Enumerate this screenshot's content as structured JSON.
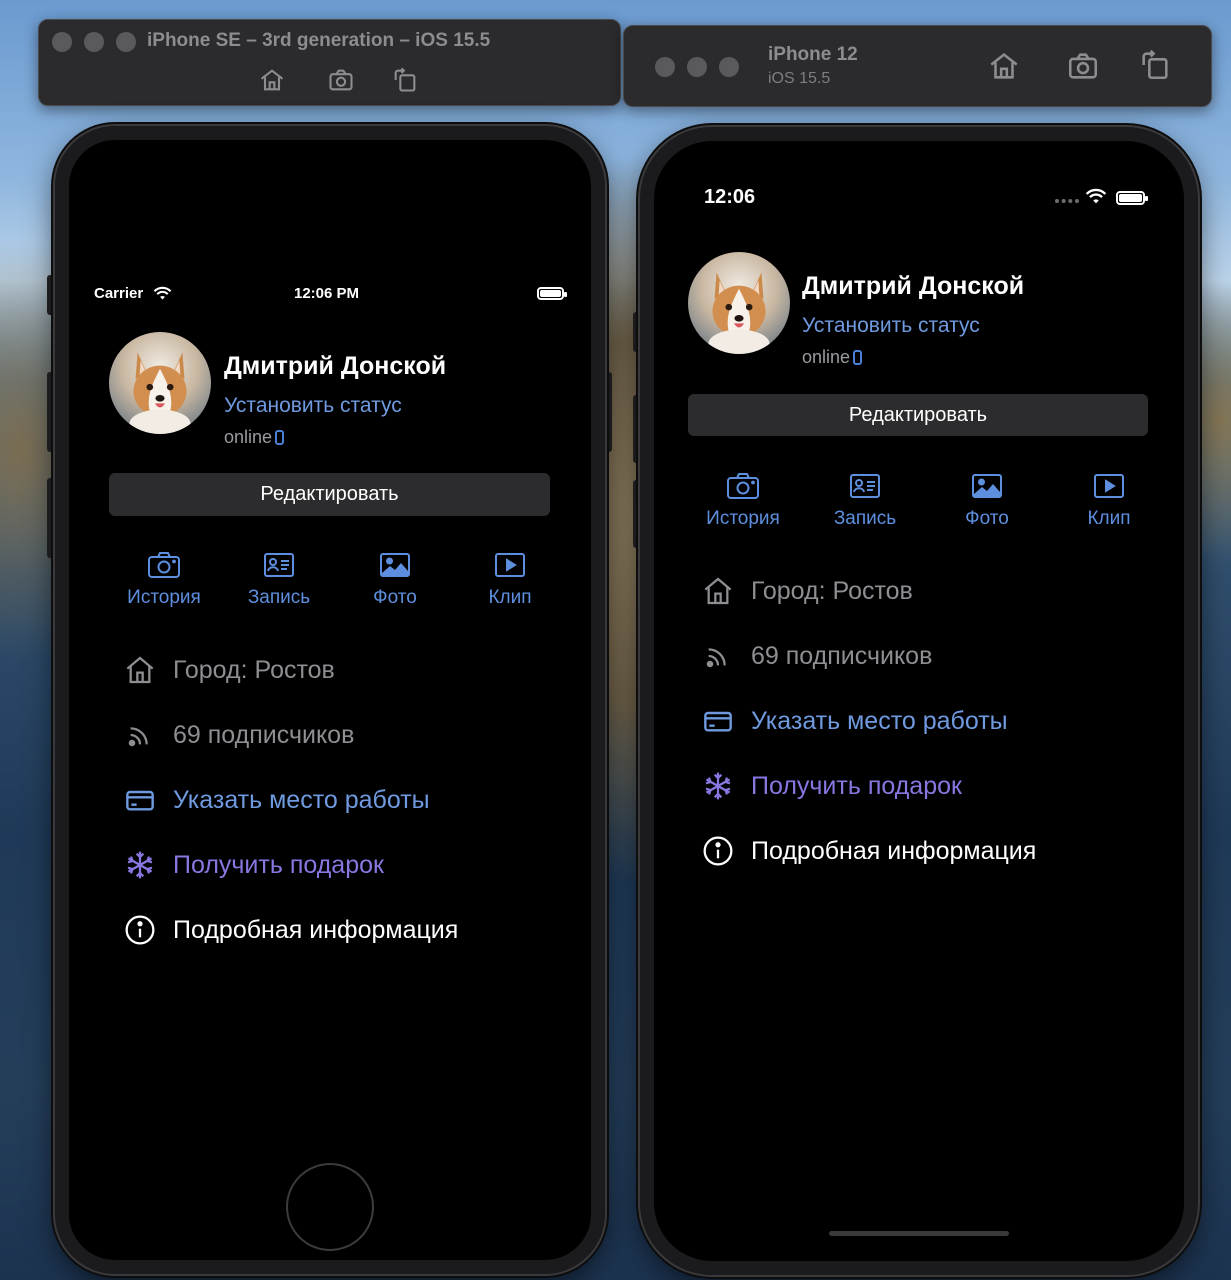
{
  "simulators": [
    {
      "title": "iPhone SE – 3rd generation – iOS 15.5",
      "status_bar": {
        "carrier": "Carrier",
        "time": "12:06 PM"
      }
    },
    {
      "title": "iPhone 12",
      "subtitle": "iOS 15.5",
      "status_bar": {
        "time": "12:06"
      }
    }
  ],
  "profile": {
    "name": "Дмитрий Донской",
    "status_link": "Установить статус",
    "online": "online",
    "edit_label": "Редактировать"
  },
  "actions": [
    {
      "label": "История",
      "icon": "camera-icon"
    },
    {
      "label": "Запись",
      "icon": "id-card-icon"
    },
    {
      "label": "Фото",
      "icon": "photo-icon"
    },
    {
      "label": "Клип",
      "icon": "play-icon"
    }
  ],
  "info": [
    {
      "label": "Город: Ростов",
      "icon": "home-icon",
      "color": "#8e8e93"
    },
    {
      "label": "69 подписчиков",
      "icon": "rss-icon",
      "color": "#8e8e93"
    },
    {
      "label": "Указать место работы",
      "icon": "card-icon",
      "color": "#6f9ae0"
    },
    {
      "label": "Получить подарок",
      "icon": "snowflake-icon",
      "color": "#8a76e0"
    },
    {
      "label": "Подробная информация",
      "icon": "info-icon",
      "color": "#ffffff"
    }
  ],
  "colors": {
    "accent": "#5e8fde",
    "link": "#6f9ae0",
    "gift": "#8a76e0",
    "background": "#000000",
    "button": "#2c2c2e"
  }
}
